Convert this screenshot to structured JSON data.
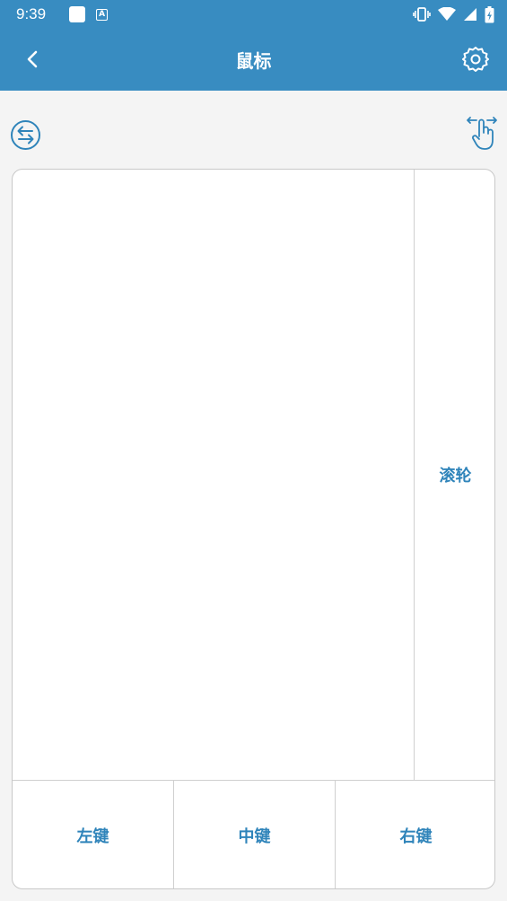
{
  "status": {
    "time": "9:39"
  },
  "appbar": {
    "title": "鼠标"
  },
  "icons": {
    "back": "chevron-left-icon",
    "settings": "gear-icon",
    "switch": "swap-arrows-icon",
    "gesture": "hand-swipe-icon"
  },
  "pad": {
    "scroll_label": "滚轮",
    "left_button": "左键",
    "middle_button": "中键",
    "right_button": "右键"
  },
  "colors": {
    "primary": "#388cc1",
    "accent_text": "#2f84ba",
    "background": "#f4f4f4"
  }
}
